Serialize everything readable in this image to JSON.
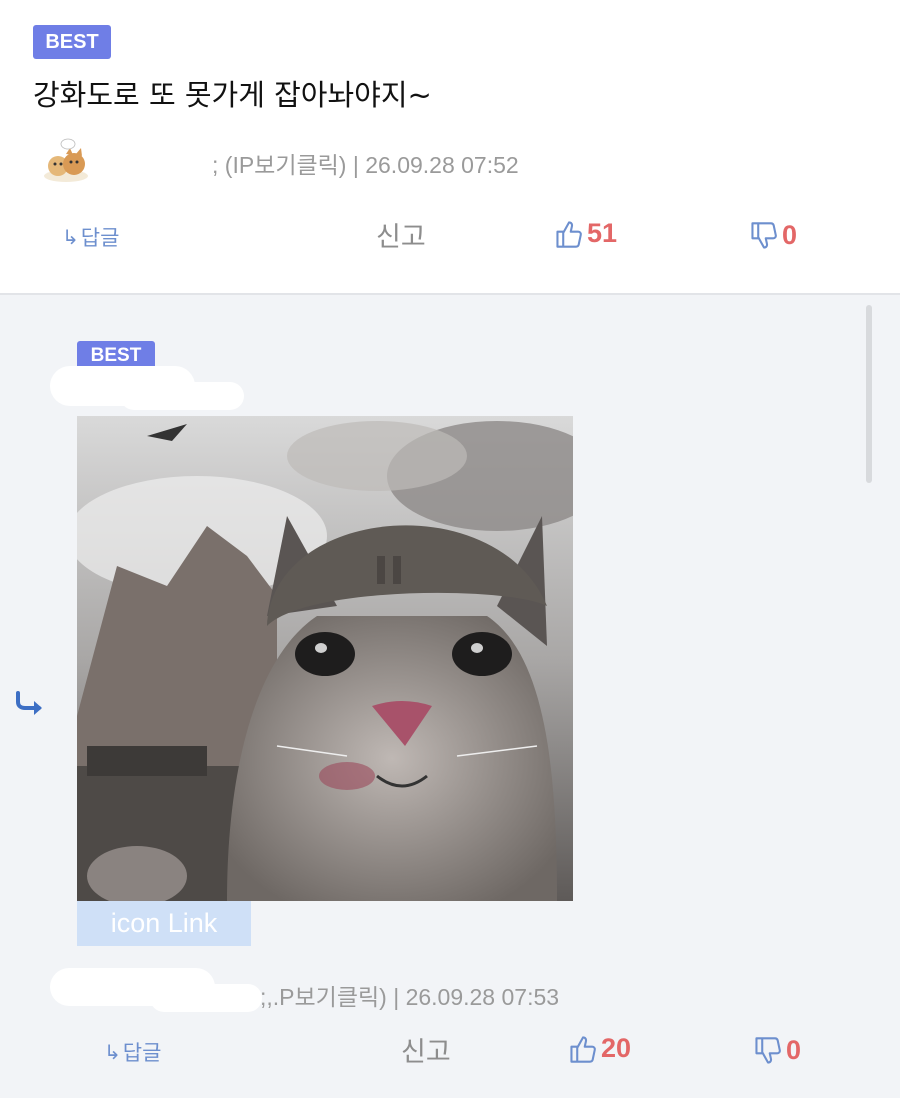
{
  "comment1": {
    "badge": "BEST",
    "text": "강화도로 또 못가게 잡아놔야지~",
    "meta": "; (IP보기클릭) | 26.09.28 07:52",
    "actions": {
      "reply": "답글",
      "report": "신고",
      "likes": "51",
      "dislikes": "0"
    }
  },
  "comment2": {
    "badge": "BEST",
    "image_link_label": "icon Link",
    "meta": ";,.P보기클릭) | 26.09.28 07:53",
    "actions": {
      "reply": "답글",
      "report": "신고",
      "likes": "20",
      "dislikes": "0"
    }
  },
  "colors": {
    "badge": "#6f7ee6",
    "reply_link": "#6d8fce",
    "vote_count": "#e36767",
    "reply_bg": "#f2f4f7"
  },
  "icons": [
    "reply-arrow-icon",
    "thumbs-up-icon",
    "thumbs-down-icon",
    "reply-indicator-icon",
    "avatar-cat"
  ]
}
